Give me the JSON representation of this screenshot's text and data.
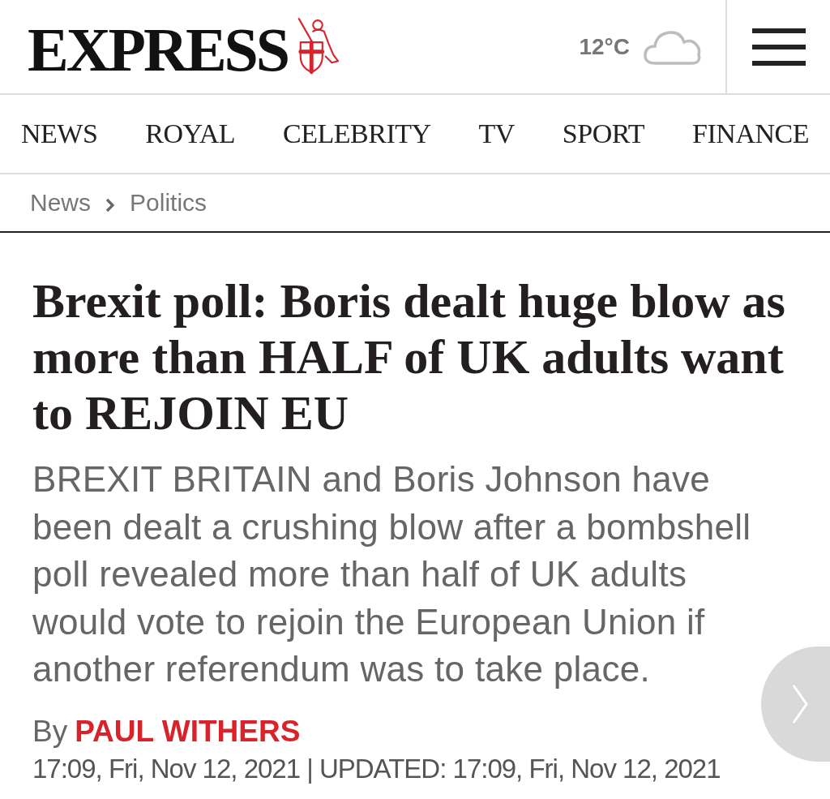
{
  "header": {
    "logo": "EXPRESS",
    "weather": {
      "temperature": "12°C"
    }
  },
  "nav": [
    {
      "label": "NEWS"
    },
    {
      "label": "ROYAL"
    },
    {
      "label": "CELEBRITY"
    },
    {
      "label": "TV"
    },
    {
      "label": "SPORT"
    },
    {
      "label": "FINANCE"
    }
  ],
  "breadcrumb": [
    {
      "label": "News"
    },
    {
      "label": "Politics"
    }
  ],
  "article": {
    "headline": "Brexit poll: Boris dealt huge blow as more than HALF of UK adults want to REJOIN EU",
    "standfirst": "BREXIT BRITAIN and Boris Johnson have been dealt a crushing blow after a bombshell poll revealed more than half of UK adults would vote to rejoin the European Union if another referendum was to take place.",
    "byline": {
      "prefix": "By",
      "author": "PAUL WITHERS"
    },
    "timestamp": "17:09, Fri, Nov 12, 2021 | UPDATED: 17:09, Fri, Nov 12, 2021"
  }
}
